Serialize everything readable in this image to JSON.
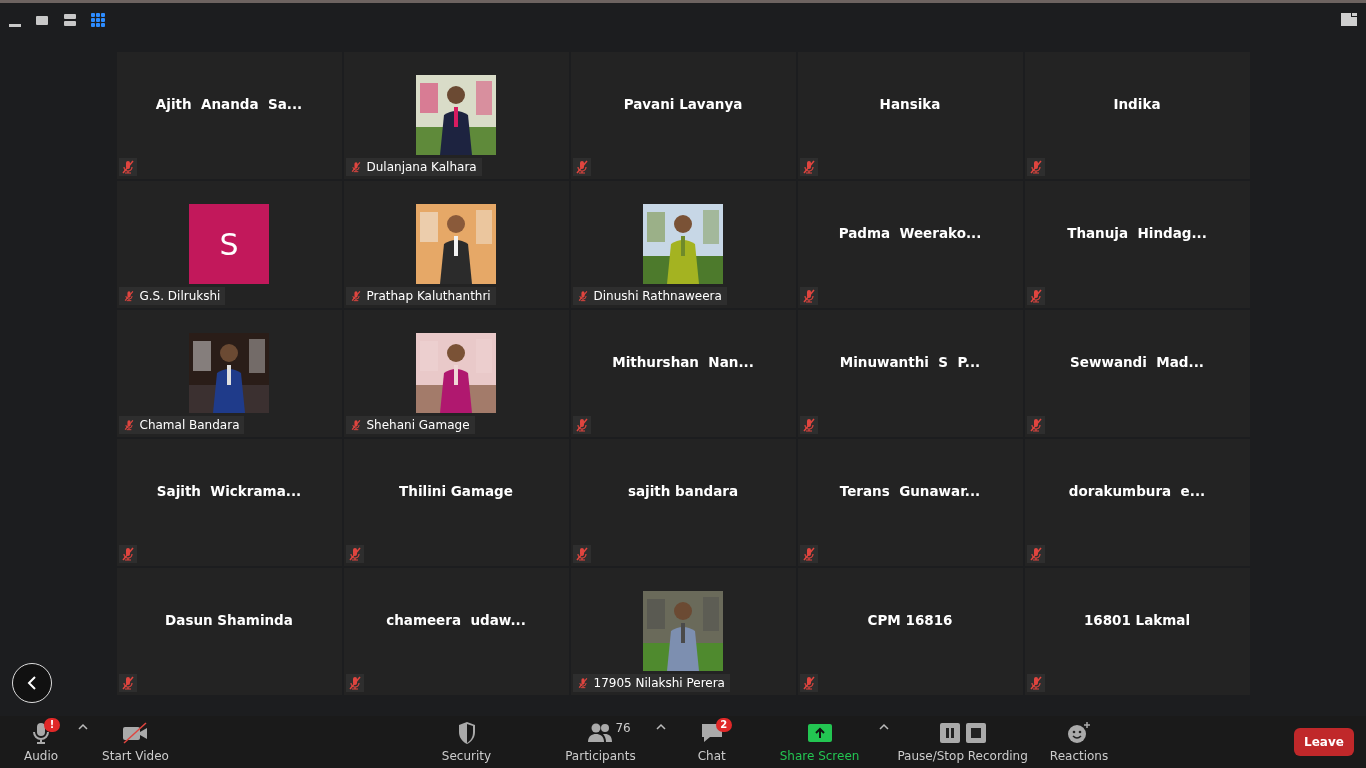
{
  "view_modes": [
    {
      "kind": "minimize",
      "selected": false
    },
    {
      "kind": "speaker",
      "selected": false
    },
    {
      "kind": "split",
      "selected": false
    },
    {
      "kind": "gallery",
      "selected": true
    }
  ],
  "tiles": [
    {
      "kind": "name",
      "name": "Ajith  Ananda  Sa..."
    },
    {
      "name": "Dulanjana Kalhara"
    },
    {
      "kind": "name",
      "name": "Pavani Lavanya"
    },
    {
      "kind": "name",
      "name": "Hansika"
    },
    {
      "kind": "name",
      "name": "Indika"
    },
    {
      "kind": "avatar",
      "letter": "S",
      "color": "#c2185b",
      "name": "G.S. Dilrukshi"
    },
    {
      "name": "Prathap Kaluthanthri"
    },
    {
      "name": "Dinushi Rathnaweera"
    },
    {
      "kind": "name",
      "name": "Padma  Weerako..."
    },
    {
      "kind": "name",
      "name": "Thanuja  Hindag..."
    },
    {
      "name": "Chamal Bandara"
    },
    {
      "name": "Shehani Gamage"
    },
    {
      "kind": "name",
      "name": "Mithurshan  Nan..."
    },
    {
      "kind": "name",
      "name": "Minuwanthi  S  P..."
    },
    {
      "kind": "name",
      "name": "Sewwandi  Mad..."
    },
    {
      "kind": "name",
      "name": "Sajith  Wickrama..."
    },
    {
      "kind": "name",
      "name": "Thilini Gamage"
    },
    {
      "kind": "name",
      "name": "sajith bandara"
    },
    {
      "kind": "name",
      "name": "Terans  Gunawar..."
    },
    {
      "kind": "name",
      "name": "dorakumbura  e..."
    },
    {
      "kind": "name",
      "name": "Dasun Shaminda"
    },
    {
      "kind": "name",
      "name": "chameera  udaw..."
    },
    {
      "name": "17905 Nilakshi Perera"
    },
    {
      "kind": "name",
      "name": "CPM 16816"
    },
    {
      "kind": "name",
      "name": "16801 Lakmal"
    }
  ],
  "toolbar": [
    {
      "kind": "audio",
      "label": "Audio",
      "badge": "!",
      "caret": true
    },
    {
      "kind": "video",
      "label": "Start Video",
      "caret": false
    },
    {
      "kind": "security",
      "label": "Security",
      "caret": false
    },
    {
      "kind": "participants",
      "label": "Participants",
      "count": "76",
      "caret": true
    },
    {
      "kind": "chat",
      "label": "Chat",
      "badge": "2",
      "caret": false
    },
    {
      "kind": "share",
      "label": "Share Screen",
      "caret": true
    },
    {
      "kind": "recording",
      "label": "Pause/Stop Recording",
      "caret": false
    },
    {
      "kind": "reactions",
      "label": "Reactions",
      "caret": false
    }
  ],
  "leave_button": "Leave"
}
